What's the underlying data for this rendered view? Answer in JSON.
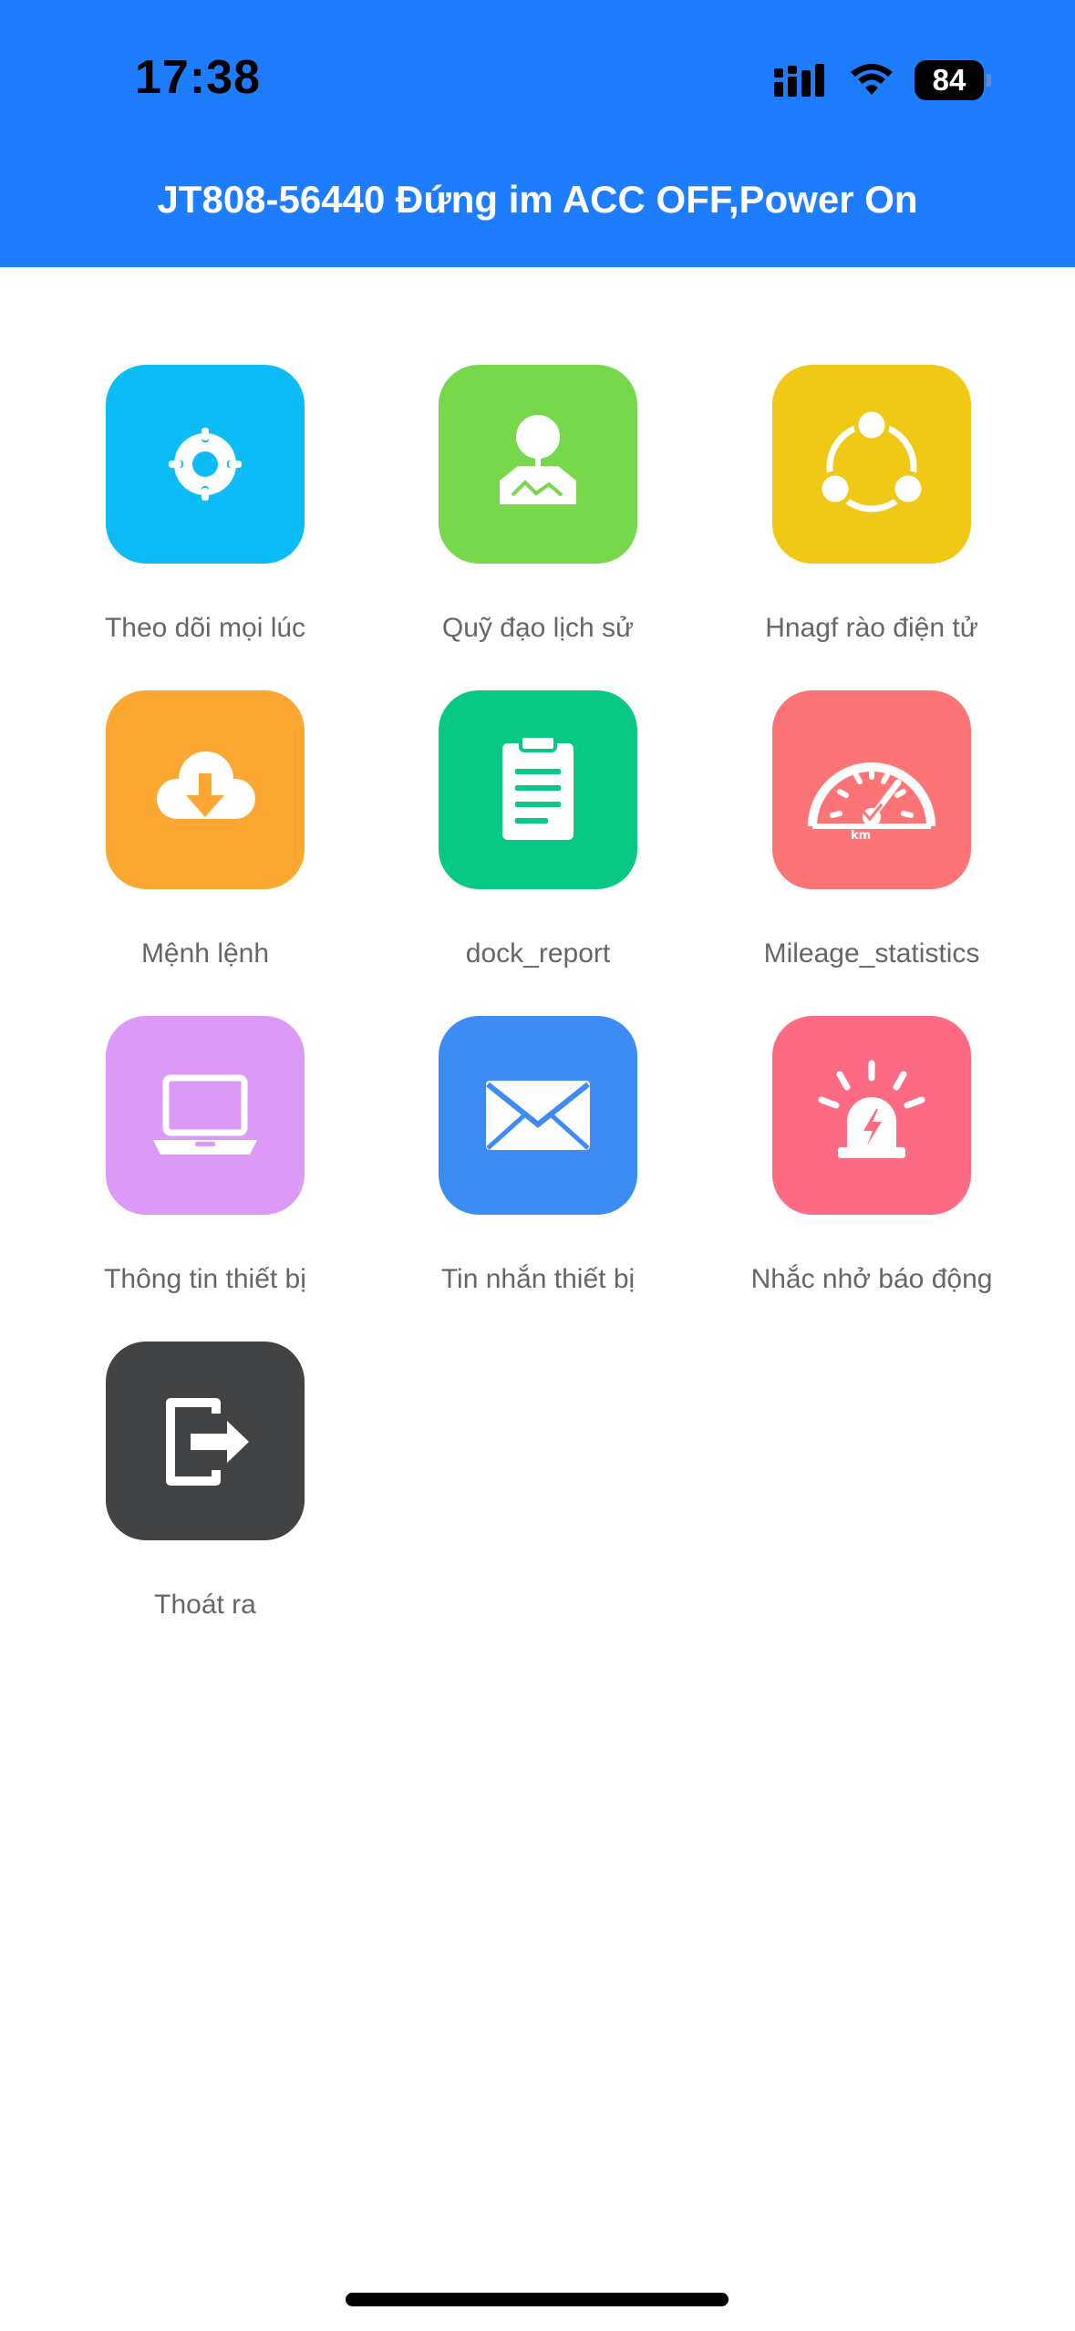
{
  "status_bar": {
    "time": "17:38",
    "battery": "84"
  },
  "header": {
    "title": "JT808-56440 Đứng im ACC OFF,Power On",
    "color": "#1e7cff"
  },
  "menu": [
    {
      "label": "Theo dõi mọi lúc",
      "icon": "target-icon",
      "color": "#0bbcf7"
    },
    {
      "label": "Quỹ đạo lịch sử",
      "icon": "map-pin-icon",
      "color": "#78d84c"
    },
    {
      "label": "Hnagf rào điện tử",
      "icon": "geofence-icon",
      "color": "#f0c816"
    },
    {
      "label": "Mệnh lệnh",
      "icon": "cloud-download-icon",
      "color": "#fba732"
    },
    {
      "label": "dock_report",
      "icon": "clipboard-icon",
      "color": "#07c983"
    },
    {
      "label": "Mileage_statistics",
      "icon": "speedometer-icon",
      "color": "#fd7476"
    },
    {
      "label": "Thông tin thiết bị",
      "icon": "laptop-icon",
      "color": "#dc9af6"
    },
    {
      "label": "Tin nhắn thiết bị",
      "icon": "envelope-icon",
      "color": "#3d8bf5"
    },
    {
      "label": "Nhắc nhở báo động",
      "icon": "alarm-light-icon",
      "color": "#fd6a84"
    },
    {
      "label": "Thoát ra",
      "icon": "exit-icon",
      "color": "#424345"
    }
  ]
}
